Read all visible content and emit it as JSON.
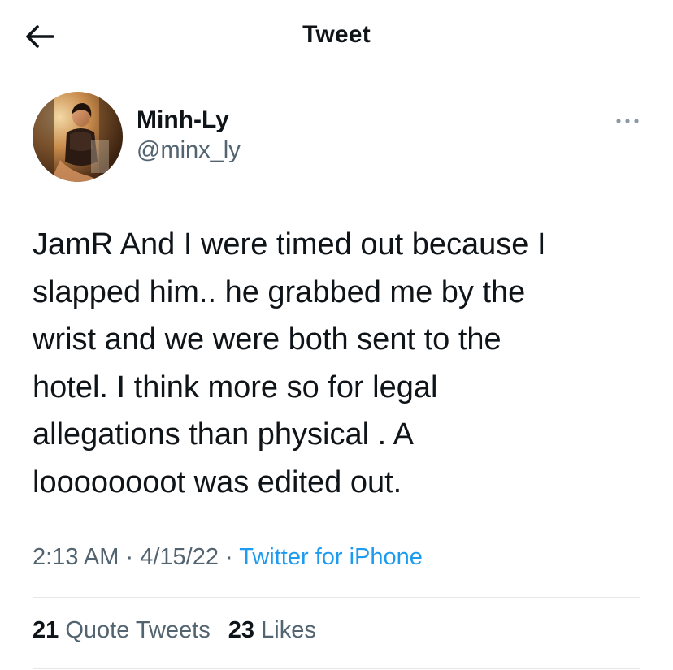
{
  "header": {
    "title": "Tweet"
  },
  "author": {
    "display_name": "Minh-Ly",
    "handle": "@minx_ly"
  },
  "tweet": {
    "text": "JamR And I were timed out because I\nslapped him.. he grabbed me by the\nwrist and we were both sent to the\nhotel. I think more so for legal\nallegations than physical . A\nloooooooot was edited out.",
    "time": "2:13 AM",
    "sep1": "·",
    "date": "4/15/22",
    "sep2": "·",
    "source": "Twitter for iPhone"
  },
  "stats": {
    "quote_tweets_count": "21",
    "quote_tweets_label": "Quote Tweets",
    "likes_count": "23",
    "likes_label": "Likes"
  },
  "colors": {
    "text": "#0f1419",
    "secondary": "#536471",
    "link": "#1d9bf0",
    "divider": "#e4e8eb"
  },
  "icons": {
    "back": "arrow-left-icon",
    "more": "more-horizontal-icon"
  }
}
